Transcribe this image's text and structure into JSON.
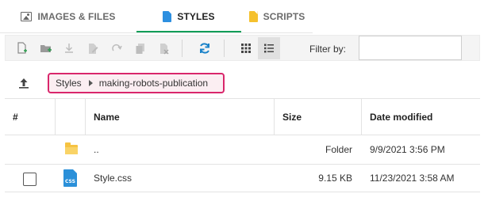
{
  "tabs": [
    {
      "label": "IMAGES & FILES",
      "icon": "image-icon",
      "active": false
    },
    {
      "label": "STYLES",
      "icon": "stylesheet-file-icon",
      "active": true
    },
    {
      "label": "SCRIPTS",
      "icon": "script-file-icon",
      "active": false
    }
  ],
  "toolbar": {
    "buttons": [
      "new-file-icon",
      "new-folder-icon",
      "download-icon",
      "edit-icon",
      "redo-icon",
      "copy-icon",
      "delete-icon",
      "refresh-icon",
      "grid-view-icon",
      "list-view-icon"
    ],
    "filter_label": "Filter by:",
    "filter_value": ""
  },
  "breadcrumb": {
    "items": [
      "Styles",
      "making-robots-publication"
    ]
  },
  "table": {
    "headers": {
      "hash": "#",
      "name": "Name",
      "size": "Size",
      "date": "Date modified"
    },
    "rows": [
      {
        "type": "folder",
        "name": "..",
        "size": "Folder",
        "date": "9/9/2021 3:56 PM"
      },
      {
        "type": "css",
        "name": "Style.css",
        "size": "9.15 KB",
        "date": "11/23/2021 3:58 AM",
        "icon_text": "CSS"
      }
    ]
  },
  "colors": {
    "accent": "#0f9d58",
    "breadcrumb_border": "#d9266b",
    "breadcrumb_bg": "#fbeef2",
    "css_icon": "#2b90d9",
    "folder_icon": "#f6c342"
  }
}
